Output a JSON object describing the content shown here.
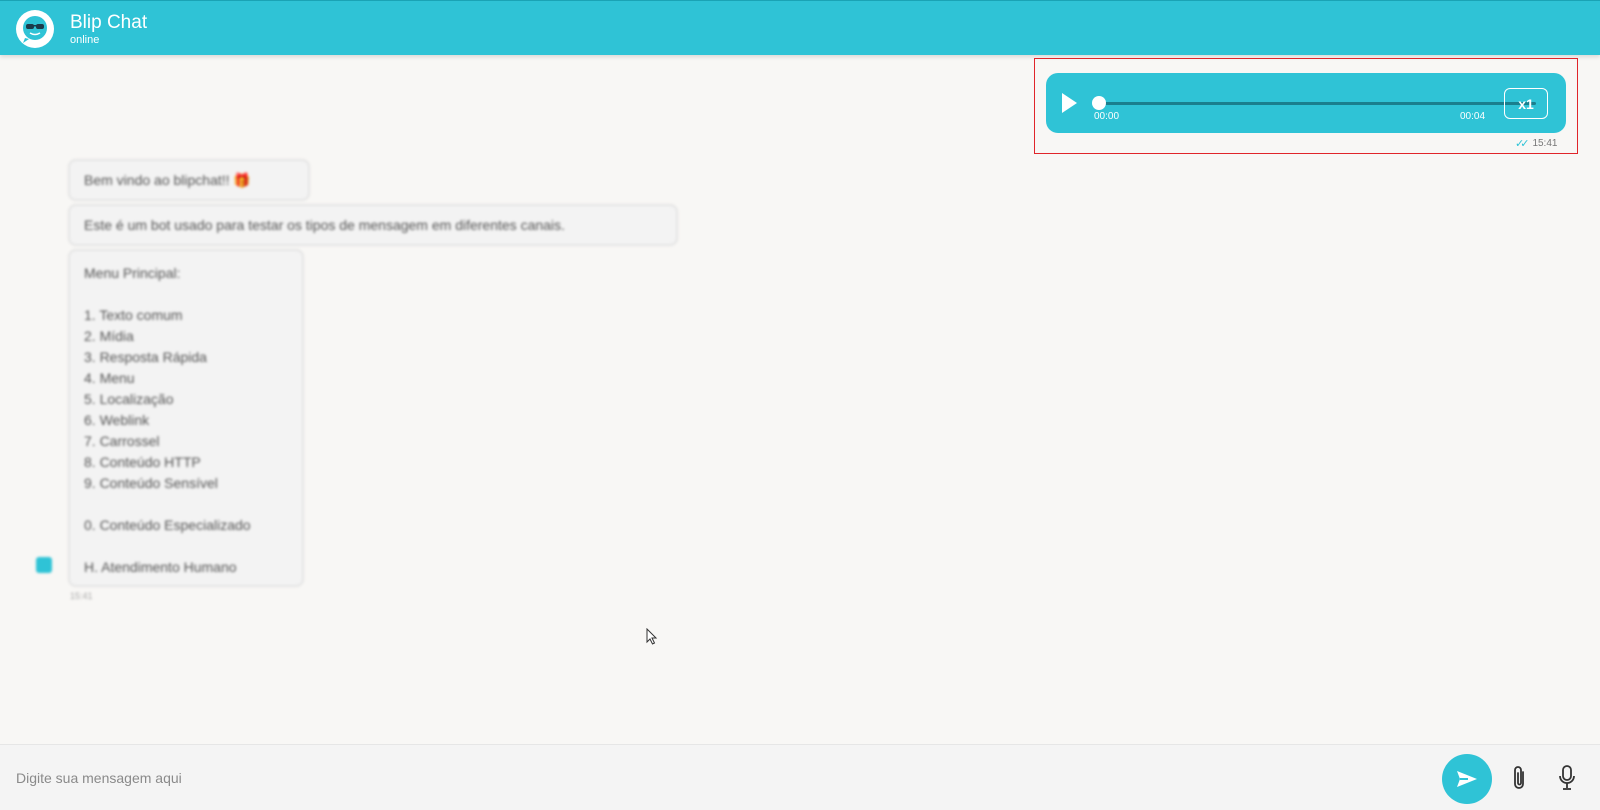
{
  "header": {
    "title": "Blip Chat",
    "status": "online"
  },
  "audio_message": {
    "elapsed": "00:00",
    "duration": "00:04",
    "speed": "x1",
    "sent_time": "15:41",
    "progress": 0
  },
  "bot_messages": {
    "welcome": "Bem vindo ao blipchat!!",
    "intro": "Este é um bot usado para testar os tipos de mensagem em diferentes canais.",
    "menu_title": "Menu Principal:",
    "menu_items": [
      "1. Texto comum",
      "2. Mídia",
      "3. Resposta Rápida",
      "4. Menu",
      "5. Localização",
      "6. Weblink",
      "7. Carrossel",
      "8. Conteúdo HTTP",
      "9. Conteúdo Sensível"
    ],
    "extra_option_1": "0. Conteúdo Especializado",
    "extra_option_2": "H. Atendimento Humano",
    "time": "15:41"
  },
  "composer": {
    "placeholder": "Digite sua mensagem aqui"
  },
  "colors": {
    "brand": "#2fc3d6",
    "highlight_border": "#e0252a",
    "background": "#f8f7f5"
  },
  "icons": {
    "logo": "chat-bot-logo-icon",
    "play": "play-icon",
    "send": "send-icon",
    "attach": "paperclip-icon",
    "mic": "microphone-icon",
    "read": "double-check-icon"
  }
}
